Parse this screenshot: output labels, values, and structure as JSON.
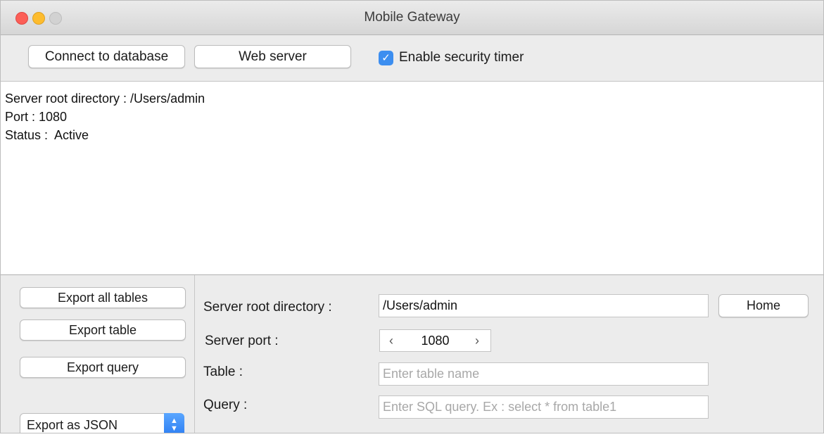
{
  "window": {
    "title": "Mobile Gateway"
  },
  "toolbar": {
    "connect_label": "Connect to database",
    "web_server_label": "Web server",
    "security_timer_label": "Enable security timer",
    "security_timer_checked": true
  },
  "log": {
    "lines": [
      "Server root directory : /Users/admin",
      "Port : 1080",
      "Status :  Active"
    ]
  },
  "export": {
    "all_tables_label": "Export all tables",
    "table_label": "Export table",
    "query_label": "Export query",
    "format_selected": "Export as JSON"
  },
  "form": {
    "root_dir_label": "Server root directory :",
    "root_dir_value": "/Users/admin",
    "home_label": "Home",
    "port_label": "Server port :",
    "port_value": "1080",
    "table_label": "Table :",
    "table_placeholder": "Enter table name",
    "query_label": "Query :",
    "query_placeholder": "Enter SQL query. Ex : select * from table1"
  },
  "icons": {
    "checkbox": "checkmark-icon",
    "stepper_left": "chevron-left-icon",
    "stepper_right": "chevron-right-icon",
    "select": "up-down-chevron-icon"
  },
  "colors": {
    "accent": "#3c8ef0",
    "close": "#fc5f57",
    "minimize": "#fdbc2e",
    "zoom_inactive": "#d2d2d2"
  }
}
